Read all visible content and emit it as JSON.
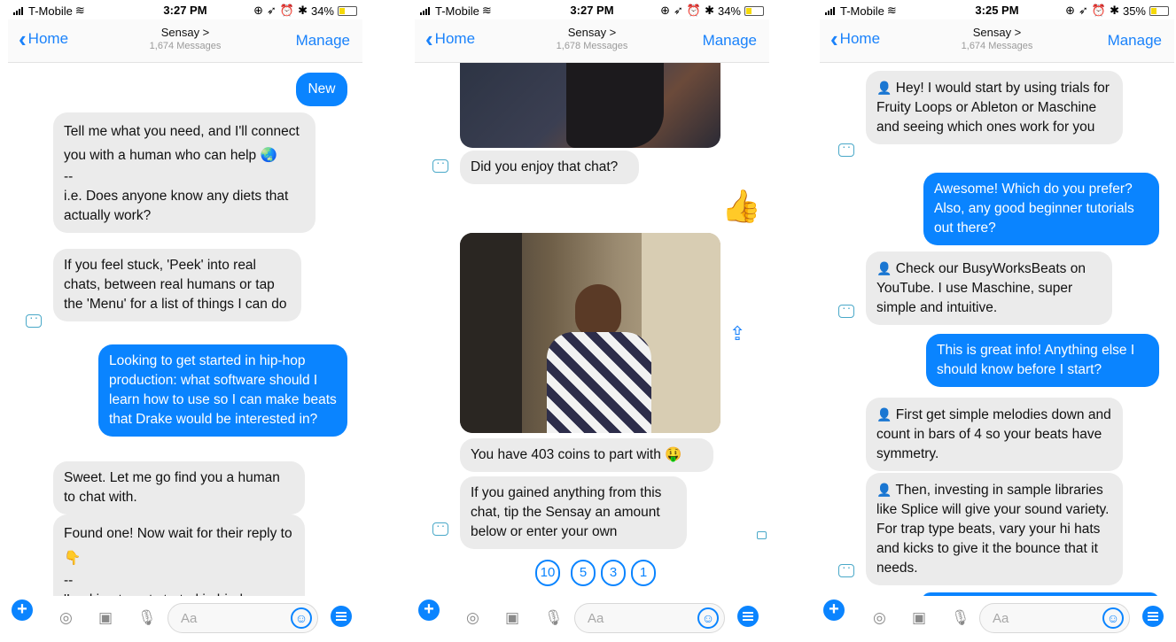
{
  "screens": [
    {
      "status": {
        "carrier": "T-Mobile",
        "time": "3:27 PM",
        "battery": "34%"
      },
      "nav": {
        "back": "Home",
        "title": "Sensay >",
        "subtitle": "1,674 Messages",
        "manage": "Manage"
      },
      "messages": {
        "new_button": "New",
        "m1_a": "Tell me what you need, and I'll connect you with a human who can help 🌏",
        "m1_b": "--",
        "m1_c": "i.e. Does anyone know any diets that actually work?",
        "m2": "If you feel stuck, 'Peek' into real chats, between real humans or tap the 'Menu' for a list of things I can do",
        "m3": "Looking to get started in hip-hop production: what software should I learn how to use so I can make beats that Drake would be interested in?",
        "m4": "Sweet. Let me go find you a human to chat with.",
        "m5_a": "Found one! Now wait for their reply to 👇",
        "m5_b": "--",
        "m5_c": "'Looking to get started in hip-hop"
      },
      "composer": {
        "placeholder": "Aa"
      }
    },
    {
      "status": {
        "carrier": "T-Mobile",
        "time": "3:27 PM",
        "battery": "34%"
      },
      "nav": {
        "back": "Home",
        "title": "Sensay >",
        "subtitle": "1,678 Messages",
        "manage": "Manage"
      },
      "messages": {
        "m1": "Did you enjoy that chat?",
        "m2": "You have 403 coins to part with 🤑",
        "m3": "If you gained anything from this chat, tip the Sensay an amount below or enter your own",
        "coins": [
          "10",
          "5",
          "3",
          "1"
        ]
      },
      "composer": {
        "placeholder": "Aa"
      }
    },
    {
      "status": {
        "carrier": "T-Mobile",
        "time": "3:25 PM",
        "battery": "35%"
      },
      "nav": {
        "back": "Home",
        "title": "Sensay >",
        "subtitle": "1,674 Messages",
        "manage": "Manage"
      },
      "messages": {
        "m1": "Hey! I would start by using trials for Fruity Loops or Ableton or Maschine and seeing which ones work for you",
        "m2": "Awesome! Which do you prefer? Also, any good beginner tutorials out there?",
        "m3": "Check our BusyWorksBeats on YouTube. I use Maschine, super simple and intuitive.",
        "m4": "This is great info! Anything else I should know before I start?",
        "m5": "First get simple melodies down and count in bars of 4 so your beats have symmetry.",
        "m6": "Then, investing in sample libraries like Splice will give your sound variety. For trap type beats, vary your hi hats and kicks to give it the bounce that it needs."
      },
      "composer": {
        "placeholder": "Aa"
      }
    }
  ],
  "colors": {
    "accent": "#0a84ff",
    "incoming_bubble": "#ebebeb",
    "outgoing_bubble": "#0a84ff"
  }
}
